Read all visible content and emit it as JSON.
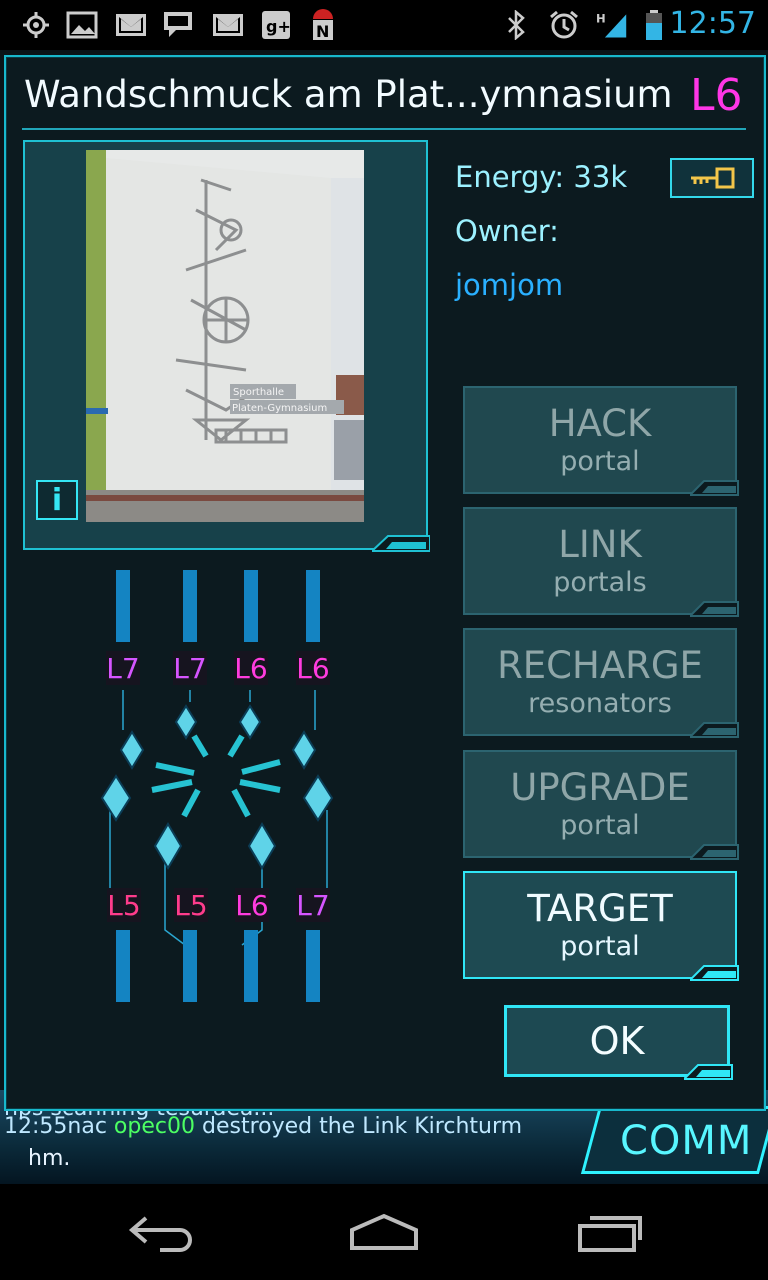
{
  "status_bar": {
    "time": "12:57",
    "left_icons": [
      "gps-icon",
      "image-icon",
      "gmail-icon",
      "chat-icon",
      "gmail-icon",
      "google-plus-icon",
      "android-news-icon"
    ],
    "right_icons": [
      "bluetooth-icon",
      "alarm-icon",
      "signal-icon",
      "battery-icon"
    ],
    "network_type": "H"
  },
  "portal": {
    "title": "Wandschmuck am Plat...ymnasium",
    "level": "L6",
    "energy_label": "Energy:",
    "energy_value": "33k",
    "owner_label": "Owner:",
    "owner_name": "jomjom",
    "info_button": "i",
    "photo_sign_line1": "Sporthalle",
    "photo_sign_line2": "Platen-Gymnasium"
  },
  "actions": [
    {
      "title": "HACK",
      "subtitle": "portal",
      "active": false
    },
    {
      "title": "LINK",
      "subtitle": "portals",
      "active": false
    },
    {
      "title": "RECHARGE",
      "subtitle": "resonators",
      "active": false
    },
    {
      "title": "UPGRADE",
      "subtitle": "portal",
      "active": false
    },
    {
      "title": "TARGET",
      "subtitle": "portal",
      "active": true
    }
  ],
  "ok_label": "OK",
  "resonators": {
    "top": [
      "L7",
      "L7",
      "L6",
      "L6"
    ],
    "bottom": [
      "L5",
      "L5",
      "L6",
      "L7"
    ]
  },
  "comm": {
    "line1_prefix": "12:55nac",
    "line1_agent": "opec00",
    "line1_rest": "destroyed the Link Kirchturm",
    "line0": "nps scanning tesuraea...",
    "line2": "hm.",
    "button_label": "COMM"
  },
  "colors": {
    "accent": "#30e6f6",
    "level_magenta": "#ff36e6",
    "owner_blue": "#2ab0ff",
    "resonator_bar": "#1484c2",
    "status_time": "#33b5e5"
  }
}
